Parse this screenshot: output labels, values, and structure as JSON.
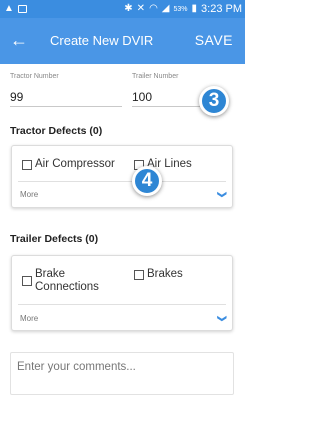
{
  "status_bar": {
    "left_icons": [
      "warning-icon",
      "image-icon"
    ],
    "right_icons": [
      "bluetooth-icon",
      "mute-icon",
      "wifi-icon",
      "signal-icon",
      "battery-icon"
    ],
    "battery": "53%",
    "time": "3:23 PM"
  },
  "app_bar": {
    "back_icon": "←",
    "title": "Create New DVIR",
    "save_label": "SAVE",
    "color": "#4a96e6"
  },
  "tractor_number": {
    "label": "Tractor Number",
    "value": "99"
  },
  "trailer_number": {
    "label": "Trailer Number",
    "value": "100"
  },
  "markers": [
    "3",
    "4"
  ],
  "tractor_defects": {
    "title": "Tractor Defects (0)",
    "items": [
      "Air Compressor",
      "Air Lines"
    ],
    "more_label": "More"
  },
  "trailer_defects": {
    "title": "Trailer Defects (0)",
    "items": [
      "Brake Connections",
      "Brakes"
    ],
    "more_label": "More"
  },
  "comments": {
    "placeholder": "Enter your comments..."
  }
}
